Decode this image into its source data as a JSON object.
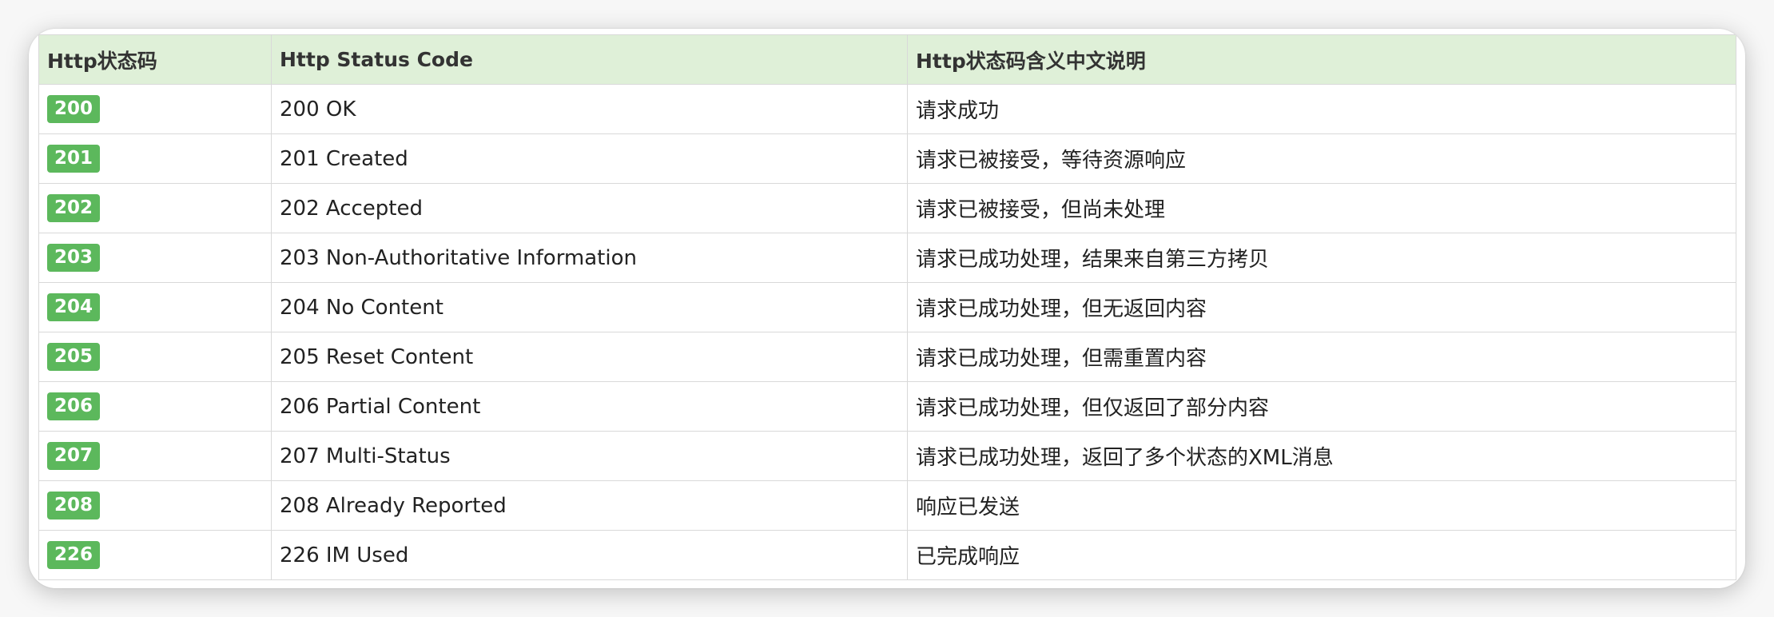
{
  "table": {
    "headers": [
      "Http状态码",
      "Http Status Code",
      "Http状态码含义中文说明"
    ],
    "rows": [
      {
        "code": "200",
        "status": "200 OK",
        "desc": "请求成功"
      },
      {
        "code": "201",
        "status": "201 Created",
        "desc": "请求已被接受，等待资源响应"
      },
      {
        "code": "202",
        "status": "202 Accepted",
        "desc": "请求已被接受，但尚未处理"
      },
      {
        "code": "203",
        "status": "203 Non-Authoritative Information",
        "desc": "请求已成功处理，结果来自第三方拷贝"
      },
      {
        "code": "204",
        "status": "204 No Content",
        "desc": "请求已成功处理，但无返回内容"
      },
      {
        "code": "205",
        "status": "205 Reset Content",
        "desc": "请求已成功处理，但需重置内容"
      },
      {
        "code": "206",
        "status": "206 Partial Content",
        "desc": "请求已成功处理，但仅返回了部分内容"
      },
      {
        "code": "207",
        "status": "207 Multi-Status",
        "desc": "请求已成功处理，返回了多个状态的XML消息"
      },
      {
        "code": "208",
        "status": "208 Already Reported",
        "desc": "响应已发送"
      },
      {
        "code": "226",
        "status": "226 IM Used",
        "desc": "已完成响应"
      }
    ]
  },
  "colors": {
    "header_bg": "#dff0d8",
    "badge_bg": "#5cb85c",
    "border": "#d9d9d9"
  }
}
